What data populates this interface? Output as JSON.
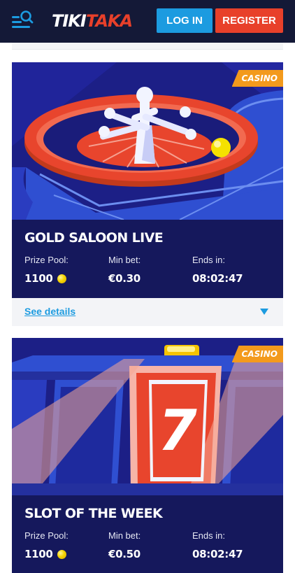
{
  "header": {
    "logo_part1": "TIKI",
    "logo_part2": "TAKA",
    "login_label": "LOG IN",
    "register_label": "REGISTER",
    "menu_icon": "menu-search-icon",
    "colors": {
      "bg": "#141937",
      "login": "#1c9be0",
      "register": "#e8402a"
    }
  },
  "tournaments": [
    {
      "title": "GOLD SALOON LIVE",
      "badge": "CASINO",
      "image_icon": "roulette-illustration",
      "prize_pool_label": "Prize Pool:",
      "prize_pool_value": "1100",
      "min_bet_label": "Min bet:",
      "min_bet_value": "€0.30",
      "ends_label": "Ends in:",
      "ends_value": "08:02:47",
      "details_label": "See details"
    },
    {
      "title": "SLOT OF THE WEEK",
      "badge": "CASINO",
      "image_icon": "slot-machine-illustration",
      "prize_pool_label": "Prize Pool:",
      "prize_pool_value": "1100",
      "min_bet_label": "Min bet:",
      "min_bet_value": "€0.50",
      "ends_label": "Ends in:",
      "ends_value": "08:02:47",
      "slot_symbol": "7"
    }
  ]
}
